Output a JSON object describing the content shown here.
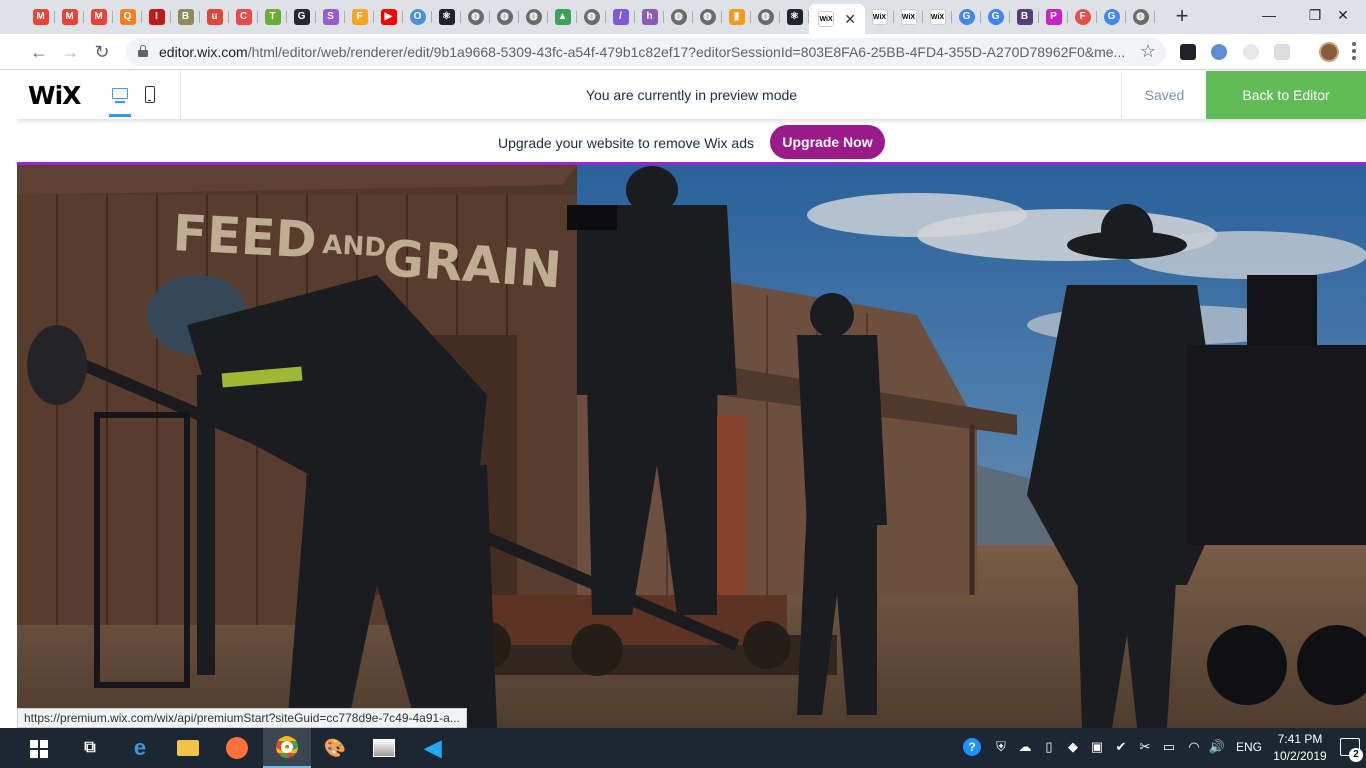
{
  "browser": {
    "tabs": [
      {
        "icon": "gmail-icon",
        "letter": "M",
        "color": "#ea4335"
      },
      {
        "icon": "gmail-icon",
        "letter": "M",
        "color": "#ea4335"
      },
      {
        "icon": "gmail-icon",
        "letter": "M",
        "color": "#ea4335"
      },
      {
        "icon": "orange-app-icon",
        "letter": "Q",
        "color": "#f4811f"
      },
      {
        "icon": "red-app-icon",
        "letter": "I",
        "color": "#c21818"
      },
      {
        "icon": "yellow-app-icon",
        "letter": "B",
        "color": "#8f8a5c"
      },
      {
        "icon": "u-app-icon",
        "letter": "u",
        "color": "#e0453a"
      },
      {
        "icon": "calendar-app-icon",
        "letter": "C",
        "color": "#e64b4b"
      },
      {
        "icon": "chat-app-icon",
        "letter": "T",
        "color": "#6bab3a"
      },
      {
        "icon": "github-icon",
        "letter": "G",
        "color": "#24292e"
      },
      {
        "icon": "purple-app-icon",
        "letter": "S",
        "color": "#9b59d0"
      },
      {
        "icon": "flame-app-icon",
        "letter": "F",
        "color": "#f5a623"
      },
      {
        "icon": "youtube-icon",
        "letter": "▶",
        "color": "#ff0000"
      },
      {
        "icon": "blue-ring-app-icon",
        "letter": "O",
        "color": "#4a90e2"
      },
      {
        "icon": "react-icon",
        "letter": "⚛",
        "color": "#20232a"
      },
      {
        "icon": "globe-icon",
        "letter": "◍",
        "color": "#6b6b6b"
      },
      {
        "icon": "globe-icon",
        "letter": "◍",
        "color": "#6b6b6b"
      },
      {
        "icon": "globe-icon",
        "letter": "◍",
        "color": "#6b6b6b"
      },
      {
        "icon": "tree-app-icon",
        "letter": "▲",
        "color": "#3aa05a"
      },
      {
        "icon": "globe-icon",
        "letter": "◍",
        "color": "#6b6b6b"
      },
      {
        "icon": "stripes-app-icon",
        "letter": "/",
        "color": "#7c5cd6"
      },
      {
        "icon": "h-app-icon",
        "letter": "h",
        "color": "#8a5cb5"
      },
      {
        "icon": "globe-icon",
        "letter": "◍",
        "color": "#6b6b6b"
      },
      {
        "icon": "globe-icon",
        "letter": "◍",
        "color": "#6b6b6b"
      },
      {
        "icon": "bars-app-icon",
        "letter": "▮",
        "color": "#f29b1d"
      },
      {
        "icon": "globe-icon",
        "letter": "◍",
        "color": "#6b6b6b"
      },
      {
        "icon": "react-icon",
        "letter": "⚛",
        "color": "#20232a"
      }
    ],
    "active_tab": {
      "icon": "wix-icon",
      "label": "WiX"
    },
    "tabs_after": [
      {
        "icon": "wix-icon",
        "letter": "WiX",
        "color": "#ffffff"
      },
      {
        "icon": "wix-icon",
        "letter": "WiX",
        "color": "#ffffff"
      },
      {
        "icon": "wix-icon",
        "letter": "WiX",
        "color": "#ffffff"
      },
      {
        "icon": "google-icon",
        "letter": "G",
        "color": "#4285f4"
      },
      {
        "icon": "google-icon",
        "letter": "G",
        "color": "#4285f4"
      },
      {
        "icon": "b-app-icon",
        "letter": "B",
        "color": "#563d7c"
      },
      {
        "icon": "p-app-icon",
        "letter": "P",
        "color": "#c724c7"
      },
      {
        "icon": "f-app-icon",
        "letter": "F",
        "color": "#e94e47"
      },
      {
        "icon": "google-icon",
        "letter": "G",
        "color": "#4285f4"
      },
      {
        "icon": "globe-icon",
        "letter": "◍",
        "color": "#6b6b6b"
      }
    ],
    "new_tab_label": "+",
    "close_tab_label": "✕",
    "window": {
      "minimize": "—",
      "maximize": "❐",
      "close": "✕"
    },
    "url_host": "editor.wix.com",
    "url_path": "/html/editor/web/renderer/edit/9b1a9668-5309-43fc-a54f-479b1c82ef17?editorSessionId=803E8FA6-25BB-4FD4-355D-A270D78962F0&me...",
    "status_link": "https://premium.wix.com/wix/api/premiumStart?siteGuid=cc778d9e-7c49-4a91-a..."
  },
  "wix": {
    "logo": "WiX",
    "preview_message": "You are currently in preview mode",
    "saved_label": "Saved",
    "back_button": "Back to Editor",
    "ad_text": "Upgrade your website to remove Wix ads",
    "upgrade_button": "Upgrade Now",
    "sign_text_1": "FEED",
    "sign_text_2": "AND",
    "sign_text_3": "GRAIN",
    "accent": "#60bc57",
    "upgrade_color": "#9a1a8a"
  },
  "taskbar": {
    "language": "ENG",
    "time": "7:41 PM",
    "date": "10/2/2019",
    "notifications": "2"
  }
}
